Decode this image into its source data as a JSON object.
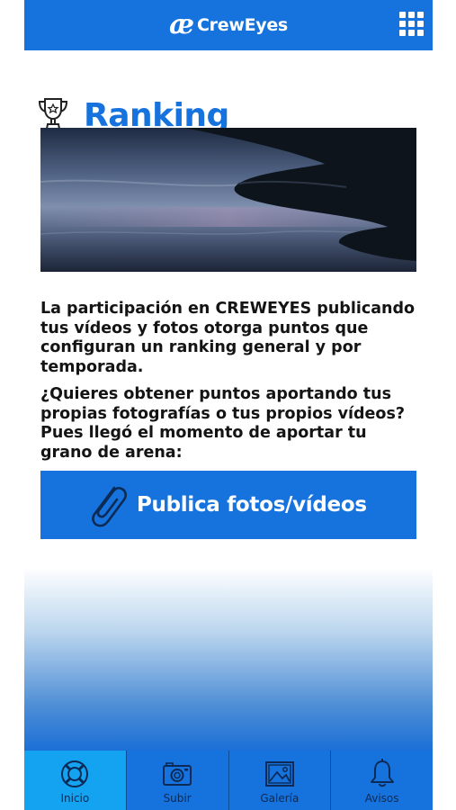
{
  "header": {
    "logo_mark": "æ",
    "brand": "CrewEyes",
    "menu_icon": "grid-menu-icon"
  },
  "page": {
    "title": "Ranking",
    "title_icon": "trophy-icon",
    "paragraphs": [
      "La participación en CREWEYES publicando tus vídeos y fotos otorga puntos que configuran un ranking general y por temporada.",
      "¿Quieres obtener puntos aportando tus propias fotografías o tus propios vídeos? Pues llegó el momento de aportar tu grano de arena:"
    ],
    "cta": {
      "label": "Publica fotos/vídeos",
      "icon": "paperclip-icon"
    }
  },
  "tabs": [
    {
      "label": "Inicio",
      "icon": "lifebuoy-icon",
      "active": true
    },
    {
      "label": "Subir",
      "icon": "camera-icon",
      "active": false
    },
    {
      "label": "Galería",
      "icon": "image-icon",
      "active": false
    },
    {
      "label": "Avisos",
      "icon": "bell-icon",
      "active": false
    }
  ],
  "colors": {
    "primary": "#1673dd",
    "active_tab": "#14a3f0",
    "text": "#141414"
  }
}
